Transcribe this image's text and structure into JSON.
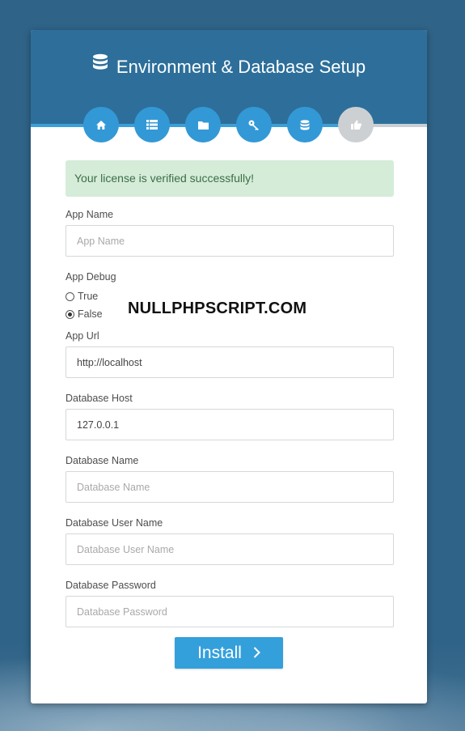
{
  "header": {
    "title": "Environment & Database Setup",
    "icon": "database-icon"
  },
  "steps": [
    {
      "icon": "home-icon",
      "state": "done"
    },
    {
      "icon": "list-icon",
      "state": "done"
    },
    {
      "icon": "folder-icon",
      "state": "done"
    },
    {
      "icon": "key-icon",
      "state": "done"
    },
    {
      "icon": "database-icon",
      "state": "current"
    },
    {
      "icon": "thumbs-up-icon",
      "state": "pending"
    }
  ],
  "alert": {
    "message": "Your license is verified successfully!"
  },
  "fields": {
    "app_name": {
      "label": "App Name",
      "value": "",
      "placeholder": "App Name"
    },
    "app_debug": {
      "label": "App Debug",
      "options": [
        "True",
        "False"
      ],
      "selected": "False"
    },
    "app_url": {
      "label": "App Url",
      "value": "http://localhost",
      "placeholder": ""
    },
    "db_host": {
      "label": "Database Host",
      "value": "127.0.0.1",
      "placeholder": ""
    },
    "db_name": {
      "label": "Database Name",
      "value": "",
      "placeholder": "Database Name"
    },
    "db_user": {
      "label": "Database User Name",
      "value": "",
      "placeholder": "Database User Name"
    },
    "db_password": {
      "label": "Database Password",
      "value": "",
      "placeholder": "Database Password"
    }
  },
  "watermark": "NULLPHPSCRIPT.COM",
  "install_button": {
    "label": "Install",
    "icon": "chevron-right-icon"
  },
  "colors": {
    "background": "#2f6387",
    "header": "#2d6f9a",
    "accent": "#3398d6",
    "step_inactive": "#cdd0d3",
    "alert_bg": "#d5ecd9",
    "alert_text": "#3c6d45"
  }
}
